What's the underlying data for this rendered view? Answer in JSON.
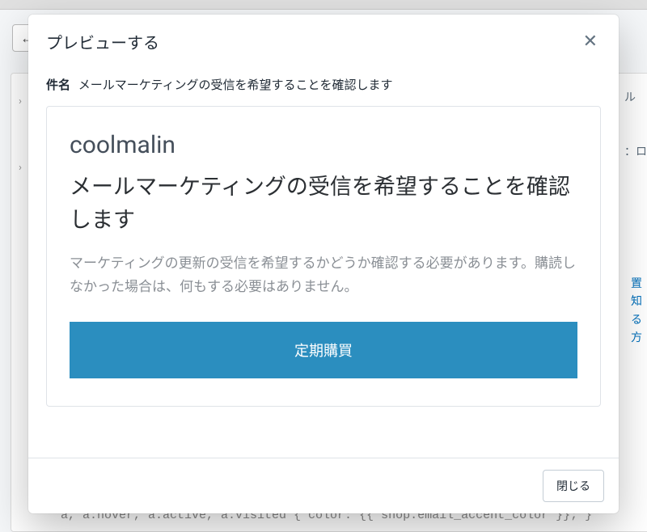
{
  "background": {
    "back_arrow": "←",
    "chevron": "›",
    "bottom_code": "a, a:hover, a:active, a:visited { color: {{ shop.email_accent_color }}; }",
    "side_fragment1": "ル",
    "side_fragment2": "：ロ",
    "side_link1": "置知",
    "side_link2": "る方"
  },
  "modal": {
    "title": "プレビューする",
    "close_icon": "✕",
    "subject_label": "件名",
    "subject_value": "メールマーケティングの受信を希望することを確認します",
    "email": {
      "brand": "coolmalin",
      "headline": "メールマーケティングの受信を希望することを確認します",
      "body": "マーケティングの更新の受信を希望するかどうか確認する必要があります。購読しなかった場合は、何もする必要はありません。",
      "cta_label": "定期購買"
    },
    "footer": {
      "close_label": "閉じる"
    }
  }
}
